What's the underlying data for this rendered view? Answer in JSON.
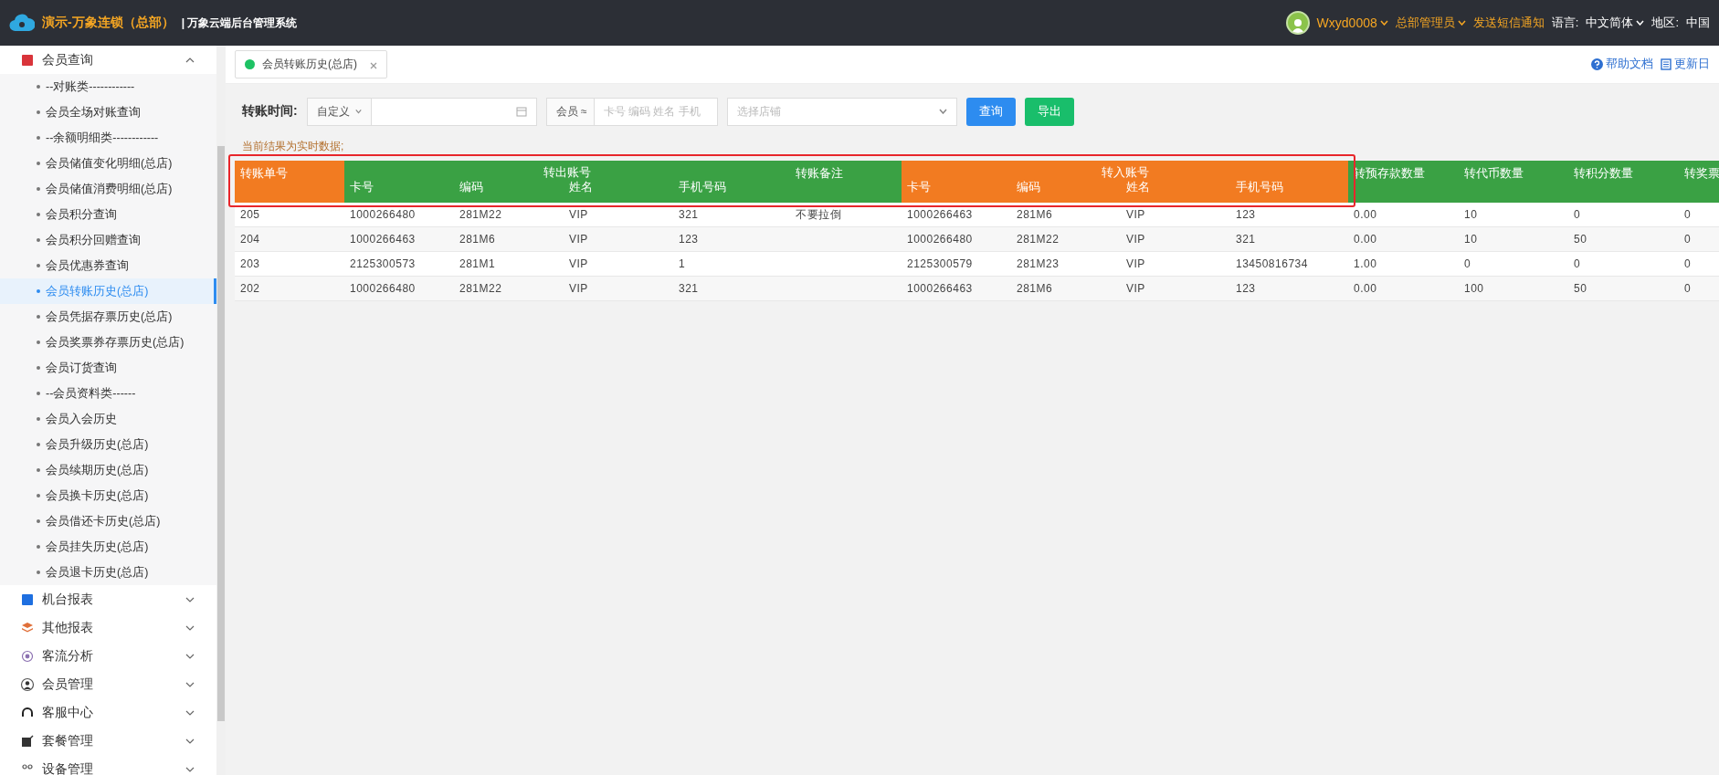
{
  "topbar": {
    "brand": "演示-万象连锁（总部）",
    "system_name": "| 万象云端后台管理系统",
    "user": "Wxyd0008",
    "role": "总部管理员",
    "sms_link": "发送短信通知",
    "language_label": "语言:",
    "language": "中文简体",
    "region_label": "地区:",
    "region": "中国"
  },
  "sidebar": {
    "groups": [
      {
        "label": "会员查询",
        "expanded": true,
        "children": [
          {
            "label": "--对账类------------",
            "selected": false
          },
          {
            "label": "会员全场对账查询",
            "selected": false
          },
          {
            "label": "--余额明细类------------",
            "selected": false
          },
          {
            "label": "会员储值变化明细(总店)",
            "selected": false
          },
          {
            "label": "会员储值消费明细(总店)",
            "selected": false
          },
          {
            "label": "会员积分查询",
            "selected": false
          },
          {
            "label": "会员积分回赠查询",
            "selected": false
          },
          {
            "label": "会员优惠券查询",
            "selected": false
          },
          {
            "label": "会员转账历史(总店)",
            "selected": true
          },
          {
            "label": "会员凭据存票历史(总店)",
            "selected": false
          },
          {
            "label": "会员奖票券存票历史(总店)",
            "selected": false
          },
          {
            "label": "会员订货查询",
            "selected": false
          },
          {
            "label": "--会员资料类------",
            "selected": false
          },
          {
            "label": "会员入会历史",
            "selected": false
          },
          {
            "label": "会员升级历史(总店)",
            "selected": false
          },
          {
            "label": "会员续期历史(总店)",
            "selected": false
          },
          {
            "label": "会员换卡历史(总店)",
            "selected": false
          },
          {
            "label": "会员借还卡历史(总店)",
            "selected": false
          },
          {
            "label": "会员挂失历史(总店)",
            "selected": false
          },
          {
            "label": "会员退卡历史(总店)",
            "selected": false
          }
        ]
      },
      {
        "label": "机台报表",
        "expanded": false
      },
      {
        "label": "其他报表",
        "expanded": false
      },
      {
        "label": "客流分析",
        "expanded": false
      },
      {
        "label": "会员管理",
        "expanded": false
      },
      {
        "label": "客服中心",
        "expanded": false
      },
      {
        "label": "套餐管理",
        "expanded": false
      },
      {
        "label": "设备管理",
        "expanded": false
      }
    ]
  },
  "tabs": [
    {
      "label": "会员转账历史(总店)",
      "selected": true
    }
  ],
  "help_links": [
    "帮助文档",
    "更新日"
  ],
  "filter": {
    "label": "转账时间:",
    "mode": "自定义",
    "member_mode": "会员 ≈",
    "member_placeholder": "卡号 编码 姓名 手机",
    "store_placeholder": "选择店铺",
    "buttons": [
      {
        "label": "查询",
        "kind": "primary"
      },
      {
        "label": "导出",
        "kind": "success"
      }
    ]
  },
  "note": "当前结果为实时数据;",
  "table": {
    "header": [
      {
        "kind": "single",
        "label": "转账单号",
        "color": "#f27b21"
      },
      {
        "kind": "group",
        "label": "转出账号",
        "color": "#3aa144",
        "columns": [
          "卡号",
          "编码",
          "姓名",
          "手机号码"
        ]
      },
      {
        "kind": "single",
        "label": "转账备注",
        "color": "#3aa144"
      },
      {
        "kind": "group",
        "label": "转入账号",
        "color": "#f27b21",
        "columns": [
          "卡号",
          "编码",
          "姓名",
          "手机号码"
        ]
      },
      {
        "kind": "single",
        "label": "转预存款数量",
        "color": "#3aa144"
      },
      {
        "kind": "single",
        "label": "转代币数量",
        "color": "#3aa144"
      },
      {
        "kind": "single",
        "label": "转积分数量",
        "color": "#3aa144"
      },
      {
        "kind": "single",
        "label": "转奖票",
        "color": "#3aa144"
      }
    ],
    "rows": [
      [
        "205",
        "1000266480",
        "281M22",
        "VIP",
        "321",
        "不要拉倒",
        "1000266463",
        "281M6",
        "VIP",
        "123",
        "0.00",
        "10",
        "0",
        "0"
      ],
      [
        "204",
        "1000266463",
        "281M6",
        "VIP",
        "123",
        "",
        "1000266480",
        "281M22",
        "VIP",
        "321",
        "0.00",
        "10",
        "50",
        "0"
      ],
      [
        "203",
        "2125300573",
        "281M1",
        "VIP",
        "1",
        "",
        "2125300579",
        "281M23",
        "VIP",
        "13450816734",
        "1.00",
        "0",
        "0",
        "0"
      ],
      [
        "202",
        "1000266480",
        "281M22",
        "VIP",
        "321",
        "",
        "1000266463",
        "281M6",
        "VIP",
        "123",
        "0.00",
        "100",
        "50",
        "0"
      ]
    ]
  }
}
